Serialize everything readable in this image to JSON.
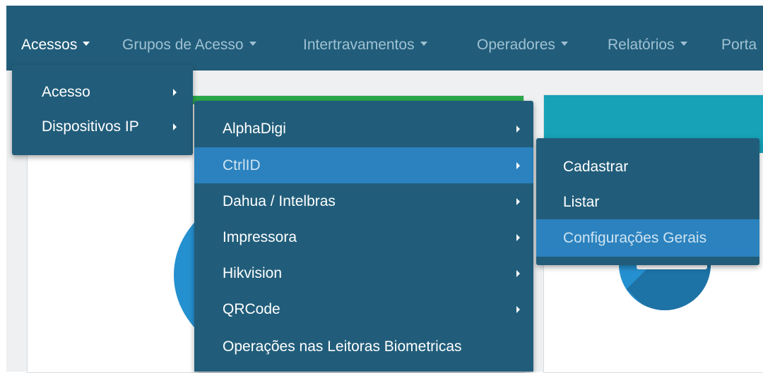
{
  "navbar": {
    "items": [
      {
        "label": "Acessos"
      },
      {
        "label": "Grupos de Acesso"
      },
      {
        "label": "Intertravamentos"
      },
      {
        "label": "Operadores"
      },
      {
        "label": "Relatórios"
      },
      {
        "label": "Porta"
      }
    ]
  },
  "menu_level1": {
    "items": [
      {
        "label": "Acesso"
      },
      {
        "label": "Dispositivos IP"
      }
    ]
  },
  "menu_level2": {
    "items": [
      {
        "label": "AlphaDigi"
      },
      {
        "label": "CtrlID"
      },
      {
        "label": "Dahua / Intelbras"
      },
      {
        "label": "Impressora"
      },
      {
        "label": "Hikvision"
      },
      {
        "label": "QRCode"
      },
      {
        "label": "Operações nas Leitoras Biometricas"
      }
    ]
  },
  "menu_level3": {
    "items": [
      {
        "label": "Cadastrar"
      },
      {
        "label": "Listar"
      },
      {
        "label": "Configurações Gerais"
      }
    ]
  },
  "colors": {
    "navbar": "#215d7a",
    "nav_inactive_text": "#9fc1d3",
    "menu_bg": "#215d7a",
    "menu_active": "#2b82be",
    "card_green": "#2aa84a",
    "card_teal": "#17a2b8",
    "icon_blue": "#2590cf"
  }
}
